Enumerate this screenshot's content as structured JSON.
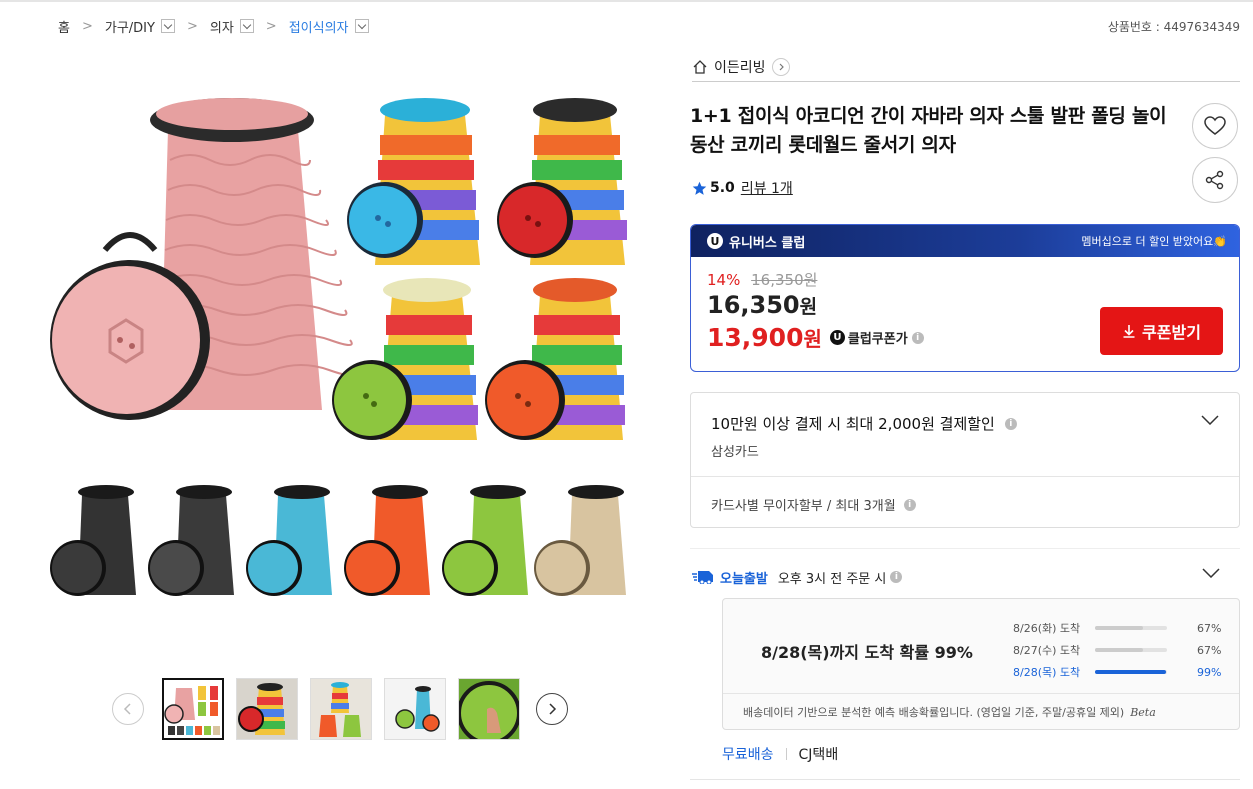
{
  "breadcrumb": {
    "home": "홈",
    "level1": "가구/DIY",
    "level2": "의자",
    "level3": "접이식의자"
  },
  "product_no": "상품번호 : 4497634349",
  "store": {
    "name": "이든리빙"
  },
  "product": {
    "title": "1+1 접이식 아코디언 간이 자바라 의자 스툴 발판 폴딩 놀이동산 코끼리 롯데월드 줄서기 의자",
    "rating": "5.0",
    "review_link": "리뷰 1개"
  },
  "price_box": {
    "badge": "U",
    "brand": "유니버스 클럽",
    "promo": "멤버십으로 더 할인 받았어요👏",
    "discount_rate": "14%",
    "original_price": "16,350원",
    "sale_price": "16,350",
    "sale_won": "원",
    "club_price": "13,900",
    "club_won": "원",
    "club_label": "클럽쿠폰가",
    "coupon_button": "쿠폰받기",
    "accent": "#e02020"
  },
  "card_offer": {
    "title": "10만원 이상 결제 시 최대 2,000원 결제할인",
    "card": "삼성카드",
    "installment": "카드사별 무이자할부 / 최대 3개월"
  },
  "delivery": {
    "label": "오늘출발",
    "desc": "오후 3시 전 주문 시",
    "probability_main": "8/28(목)까지 도착 확률 99%",
    "rows": [
      {
        "date": "8/26(화) 도착",
        "pct": "67%",
        "value": 0.67
      },
      {
        "date": "8/27(수) 도착",
        "pct": "67%",
        "value": 0.67
      },
      {
        "date": "8/28(목) 도착",
        "pct": "99%",
        "value": 0.99
      }
    ],
    "footnote": "배송데이터 기반으로 분석한 예측 배송확률입니다. (영업일 기준, 주말/공휴일 제외)",
    "beta": "Beta",
    "free_shipping": "무료배송",
    "courier": "CJ택배"
  },
  "icons": {
    "home": "home-icon",
    "heart": "heart-icon",
    "share": "share-icon",
    "star": "star-icon",
    "download": "download-icon",
    "truck": "truck-icon",
    "info": "info-icon",
    "chevron": "chevron-down-icon"
  }
}
